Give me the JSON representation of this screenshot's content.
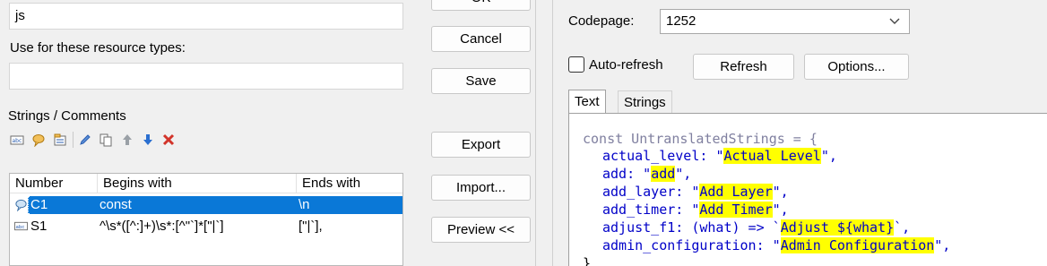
{
  "left_pane": {
    "name_value": "js",
    "resource_types_label": "Use for these resource types:",
    "resource_types_value": "",
    "strings_comments_label": "Strings / Comments",
    "toolbar_icons": [
      "add-string-icon",
      "add-comment-icon",
      "import-icon",
      "edit-icon",
      "copy-icon",
      "move-up-icon",
      "move-down-icon",
      "delete-icon"
    ],
    "table": {
      "headers": [
        "Number",
        "Begins with",
        "Ends with"
      ],
      "rows": [
        {
          "number": "C1",
          "begins": "const",
          "ends": "\\n",
          "icon": "comment-icon",
          "selected": true
        },
        {
          "number": "S1",
          "begins": "^\\s*([^:]+)\\s*:[^\"`]*[\"|`]",
          "ends": "[\"|`],",
          "icon": "string-icon",
          "selected": false
        }
      ]
    }
  },
  "buttons": {
    "ok": "OK",
    "cancel": "Cancel",
    "save": "Save",
    "export": "Export",
    "import": "Import...",
    "preview": "Preview <<"
  },
  "right_pane": {
    "codepage_label": "Codepage:",
    "codepage_value": "1252",
    "auto_refresh_label": "Auto-refresh",
    "auto_refresh_checked": false,
    "refresh_label": "Refresh",
    "options_label": "Options...",
    "tabs": [
      "Text",
      "Strings"
    ],
    "active_tab": "Text",
    "code": {
      "line0": "const UntranslatedStrings = {",
      "lines": [
        {
          "key": "actual_level: ",
          "pre": "\"",
          "val": "Actual Level",
          "post": "\","
        },
        {
          "key": "add: ",
          "pre": "\"",
          "val": "add",
          "post": "\","
        },
        {
          "key": "add_layer: ",
          "pre": "\"",
          "val": "Add Layer",
          "post": "\","
        },
        {
          "key": "add_timer: ",
          "pre": "\"",
          "val": "Add Timer",
          "post": "\","
        },
        {
          "key": "adjust_f1: (what) => ",
          "pre": "`",
          "val": "Adjust ${what}",
          "post": "`,"
        },
        {
          "key": "admin_configuration: ",
          "pre": "\"",
          "val": "Admin Configuration",
          "post": "\","
        }
      ],
      "last": "}"
    }
  },
  "colors": {
    "selection": "#0a78d7",
    "highlight": "#ffff00",
    "code_text": "#0000c8"
  }
}
